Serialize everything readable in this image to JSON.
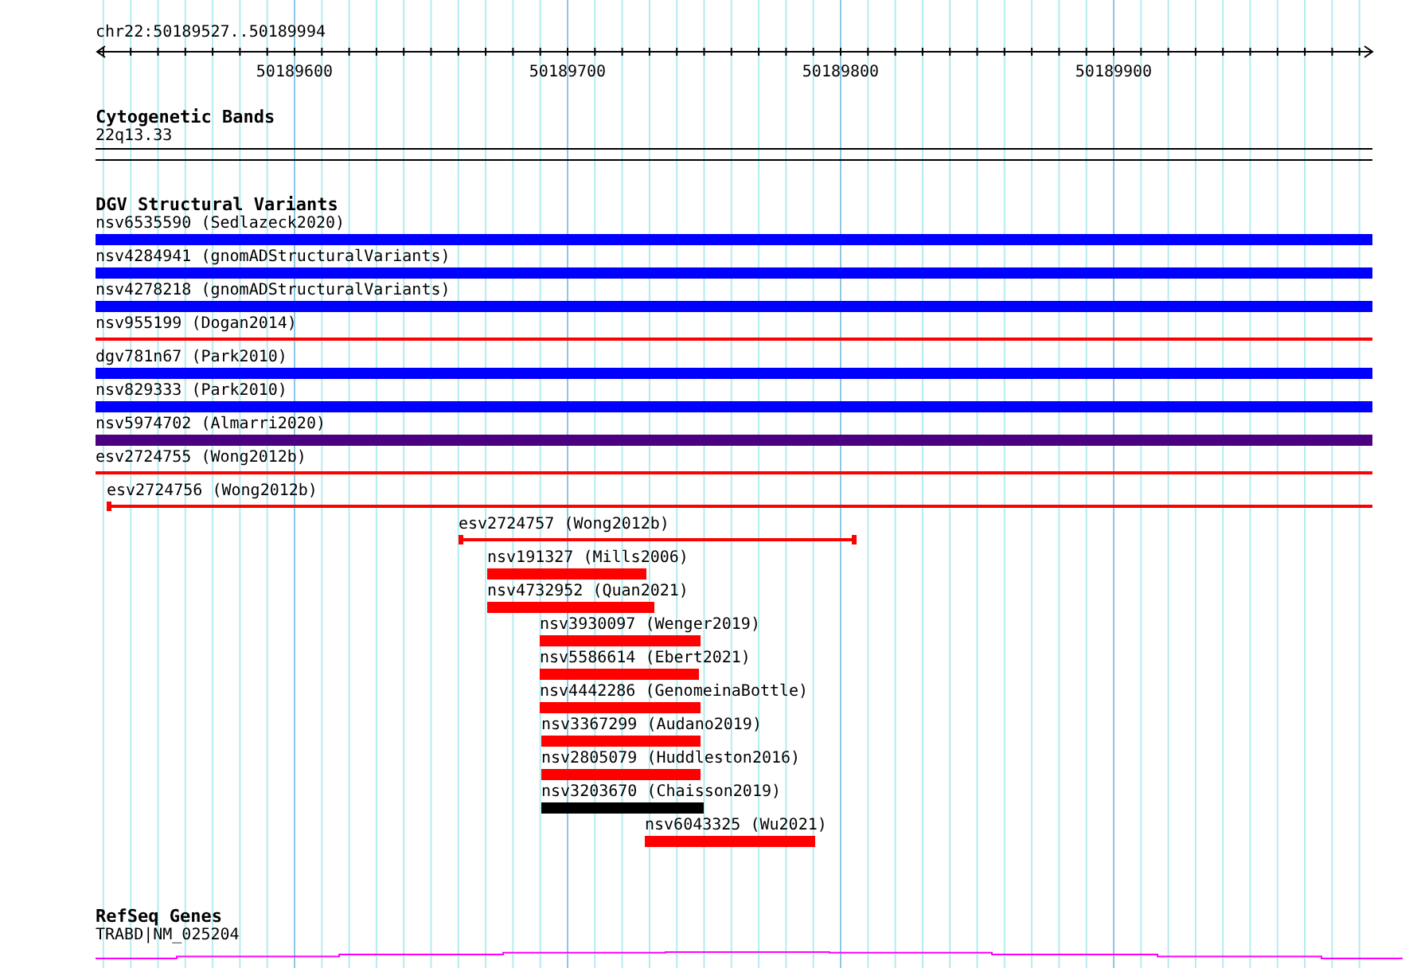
{
  "ruler": {
    "location": "chr22:50189527..50189994",
    "ticks": [
      "50189600",
      "50189700",
      "50189800",
      "50189900"
    ]
  },
  "cytogenetic_bands": {
    "title": "Cytogenetic Bands",
    "features": [
      {
        "label": "22q13.33"
      }
    ]
  },
  "dgv_structural_variants": {
    "title": "DGV Structural Variants",
    "features": [
      {
        "label": "nsv6535590 (Sedlazeck2020)",
        "kind": "bar",
        "color": "#0000ff"
      },
      {
        "label": "nsv4284941 (gnomADStructuralVariants)",
        "kind": "bar",
        "color": "#0000ff"
      },
      {
        "label": "nsv4278218 (gnomADStructuralVariants)",
        "kind": "bar",
        "color": "#0000ff"
      },
      {
        "label": "nsv955199 (Dogan2014)",
        "kind": "line",
        "color": "#ff0000"
      },
      {
        "label": "dgv781n67 (Park2010)",
        "kind": "bar",
        "color": "#0000ff"
      },
      {
        "label": "nsv829333 (Park2010)",
        "kind": "bar",
        "color": "#0000ff"
      },
      {
        "label": "nsv5974702 (Almarri2020)",
        "kind": "bar",
        "color": "#4b0082"
      },
      {
        "label": "esv2724755 (Wong2012b)",
        "kind": "line",
        "color": "#ff0000"
      },
      {
        "label": "esv2724756 (Wong2012b)",
        "kind": "line",
        "color": "#ff0000"
      },
      {
        "label": "esv2724757 (Wong2012b)",
        "kind": "line",
        "color": "#ff0000"
      },
      {
        "label": "nsv191327 (Mills2006)",
        "kind": "bar",
        "color": "#ff0000"
      },
      {
        "label": "nsv4732952 (Quan2021)",
        "kind": "bar",
        "color": "#ff0000"
      },
      {
        "label": "nsv3930097 (Wenger2019)",
        "kind": "bar",
        "color": "#ff0000"
      },
      {
        "label": "nsv5586614 (Ebert2021)",
        "kind": "bar",
        "color": "#ff0000"
      },
      {
        "label": "nsv4442286 (GenomeinaBottle)",
        "kind": "bar",
        "color": "#ff0000"
      },
      {
        "label": "nsv3367299 (Audano2019)",
        "kind": "bar",
        "color": "#ff0000"
      },
      {
        "label": "nsv2805079 (Huddleston2016)",
        "kind": "bar",
        "color": "#ff0000"
      },
      {
        "label": "nsv3203670 (Chaisson2019)",
        "kind": "bar",
        "color": "#000000"
      },
      {
        "label": "nsv6043325 (Wu2021)",
        "kind": "bar",
        "color": "#ff0000"
      }
    ]
  },
  "refseq_genes": {
    "title": "RefSeq Genes",
    "features": [
      {
        "label": "TRABD|NM_025204"
      }
    ]
  }
}
